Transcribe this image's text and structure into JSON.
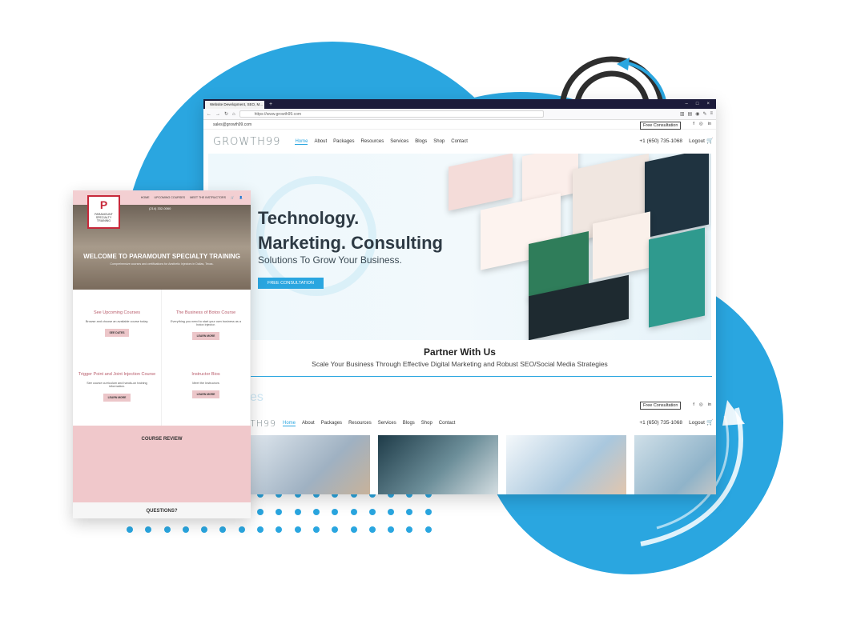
{
  "browser": {
    "tab_title": "Website Development, SEO, M...",
    "url": "https://www.growth99.com",
    "window_controls": [
      "–",
      "□",
      "×"
    ]
  },
  "growth99": {
    "top_email": "sales@growth99.com",
    "free_consultation": "Free Consultation",
    "social": [
      "f",
      "◎",
      "in"
    ],
    "logo": "GROWTH99",
    "nav": [
      "Home",
      "About",
      "Packages",
      "Resources",
      "Services",
      "Blogs",
      "Shop",
      "Contact"
    ],
    "phone": "+1 (650) 735-1068",
    "logout": "Logout",
    "hero": {
      "line1": "Technology.",
      "line2": "Marketing. Consulting",
      "subtitle": "Solutions To Grow Your Business.",
      "button": "FREE CONSULTATION"
    },
    "partner": {
      "title": "Partner With Us",
      "text": "Scale Your Business Through Effective Digital Marketing and Robust SEO/Social Media Strategies"
    },
    "logo_partial": "TH99",
    "ghost_text": "es"
  },
  "paramount": {
    "nav": [
      "HOME",
      "UPCOMING COURSES",
      "MEET THE INSTRUCTORS"
    ],
    "logo_text": "PARAMOUNT",
    "logo_sub": "SPECIALTY TRAINING",
    "phone": "(214) 332-0060",
    "title": "WELCOME TO PARAMOUNT SPECIALTY TRAINING",
    "tagline": "Comprehensive courses and certifications for Aesthetic Injectors in Dallas, Texas.",
    "cards": [
      {
        "title": "See Upcoming Courses",
        "text": "Browse and choose an available course today.",
        "button": "SEE DATES"
      },
      {
        "title": "The Business of Botox Course",
        "text": "Everything you need to start your own business as a botox injector.",
        "button": "LEARN MORE"
      },
      {
        "title": "Trigger Point and Joint Injection Course",
        "text": "See course curriculum and hands-on training information.",
        "button": "LEARN MORE"
      },
      {
        "title": "Instructor Bios",
        "text": "Meet the Instructors",
        "button": "LEARN MORE"
      }
    ],
    "review": "COURSE REVIEW",
    "questions": "QUESTIONS?"
  },
  "colors": {
    "accent": "#2aa6e0",
    "pink": "#f0c8cb",
    "dark": "#1c1b3a"
  }
}
